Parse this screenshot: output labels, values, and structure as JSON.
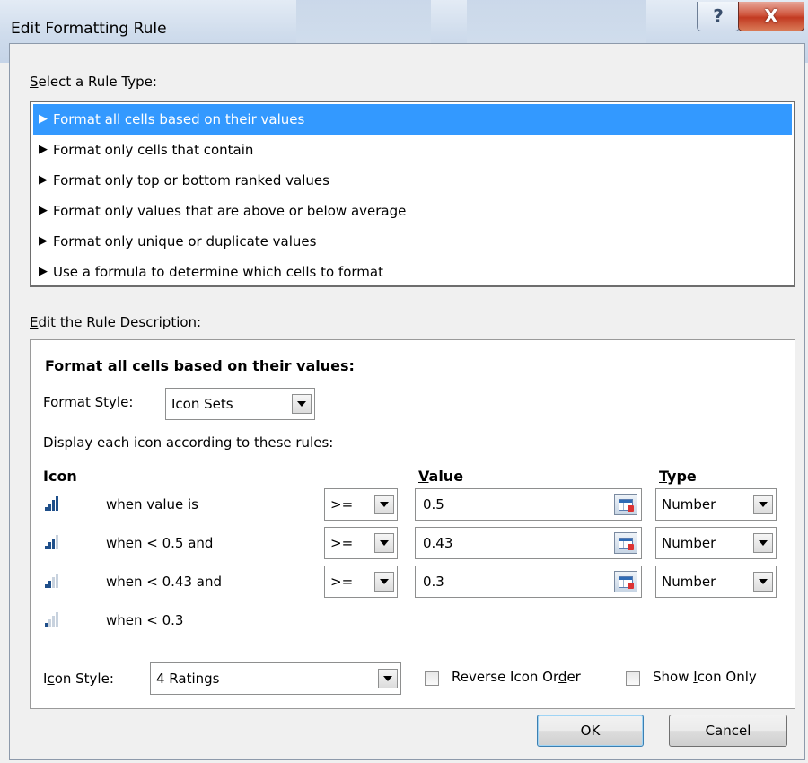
{
  "window": {
    "title": "Edit Formatting Rule",
    "help_glyph": "?",
    "close_glyph": "X"
  },
  "rule_type": {
    "label_accel": "S",
    "label_rest": "elect a Rule Type:",
    "selected_index": 0,
    "items": [
      {
        "label": "Format all cells based on their values"
      },
      {
        "label": "Format only cells that contain"
      },
      {
        "label": "Format only top or bottom ranked values"
      },
      {
        "label": "Format only values that are above or below average"
      },
      {
        "label": "Format only unique or duplicate values"
      },
      {
        "label": "Use a formula to determine which cells to format"
      }
    ]
  },
  "description": {
    "label_accel": "E",
    "label_rest": "dit the Rule Description:",
    "heading": "Format all cells based on their values:",
    "format_style": {
      "label_pre": "Fo",
      "label_accel": "r",
      "label_post": "mat Style:",
      "value": "Icon Sets"
    },
    "display_rules_text": "Display each icon according to these rules:",
    "columns": {
      "icon": "Icon",
      "value_accel": "V",
      "value_rest": "alue",
      "type_accel": "T",
      "type_rest": "ype"
    },
    "rules": [
      {
        "icon": "rating-4-bars-icon",
        "bars": 4,
        "condition": "when value is",
        "operator": ">=",
        "value": "0.5",
        "type": "Number"
      },
      {
        "icon": "rating-3-bars-icon",
        "bars": 3,
        "condition": "when < 0.5 and",
        "operator": ">=",
        "value": "0.43",
        "type": "Number"
      },
      {
        "icon": "rating-2-bars-icon",
        "bars": 2,
        "condition": "when < 0.43 and",
        "operator": ">=",
        "value": "0.3",
        "type": "Number"
      },
      {
        "icon": "rating-1-bar-icon",
        "bars": 1,
        "condition": "when < 0.3"
      }
    ],
    "icon_style": {
      "label_pre": "I",
      "label_accel": "c",
      "label_post": "on Style:",
      "value": "4 Ratings"
    },
    "reverse_order": {
      "label_pre": "Reverse Icon Or",
      "label_accel": "d",
      "label_post": "er",
      "checked": false
    },
    "show_icon_only": {
      "label_pre": "Show ",
      "label_accel": "I",
      "label_post": "con Only",
      "checked": false
    }
  },
  "buttons": {
    "ok": "OK",
    "cancel": "Cancel"
  },
  "colors": {
    "selection": "#3399ff",
    "icon_on": "#1f4f8a",
    "icon_off": "#c8d2de"
  }
}
